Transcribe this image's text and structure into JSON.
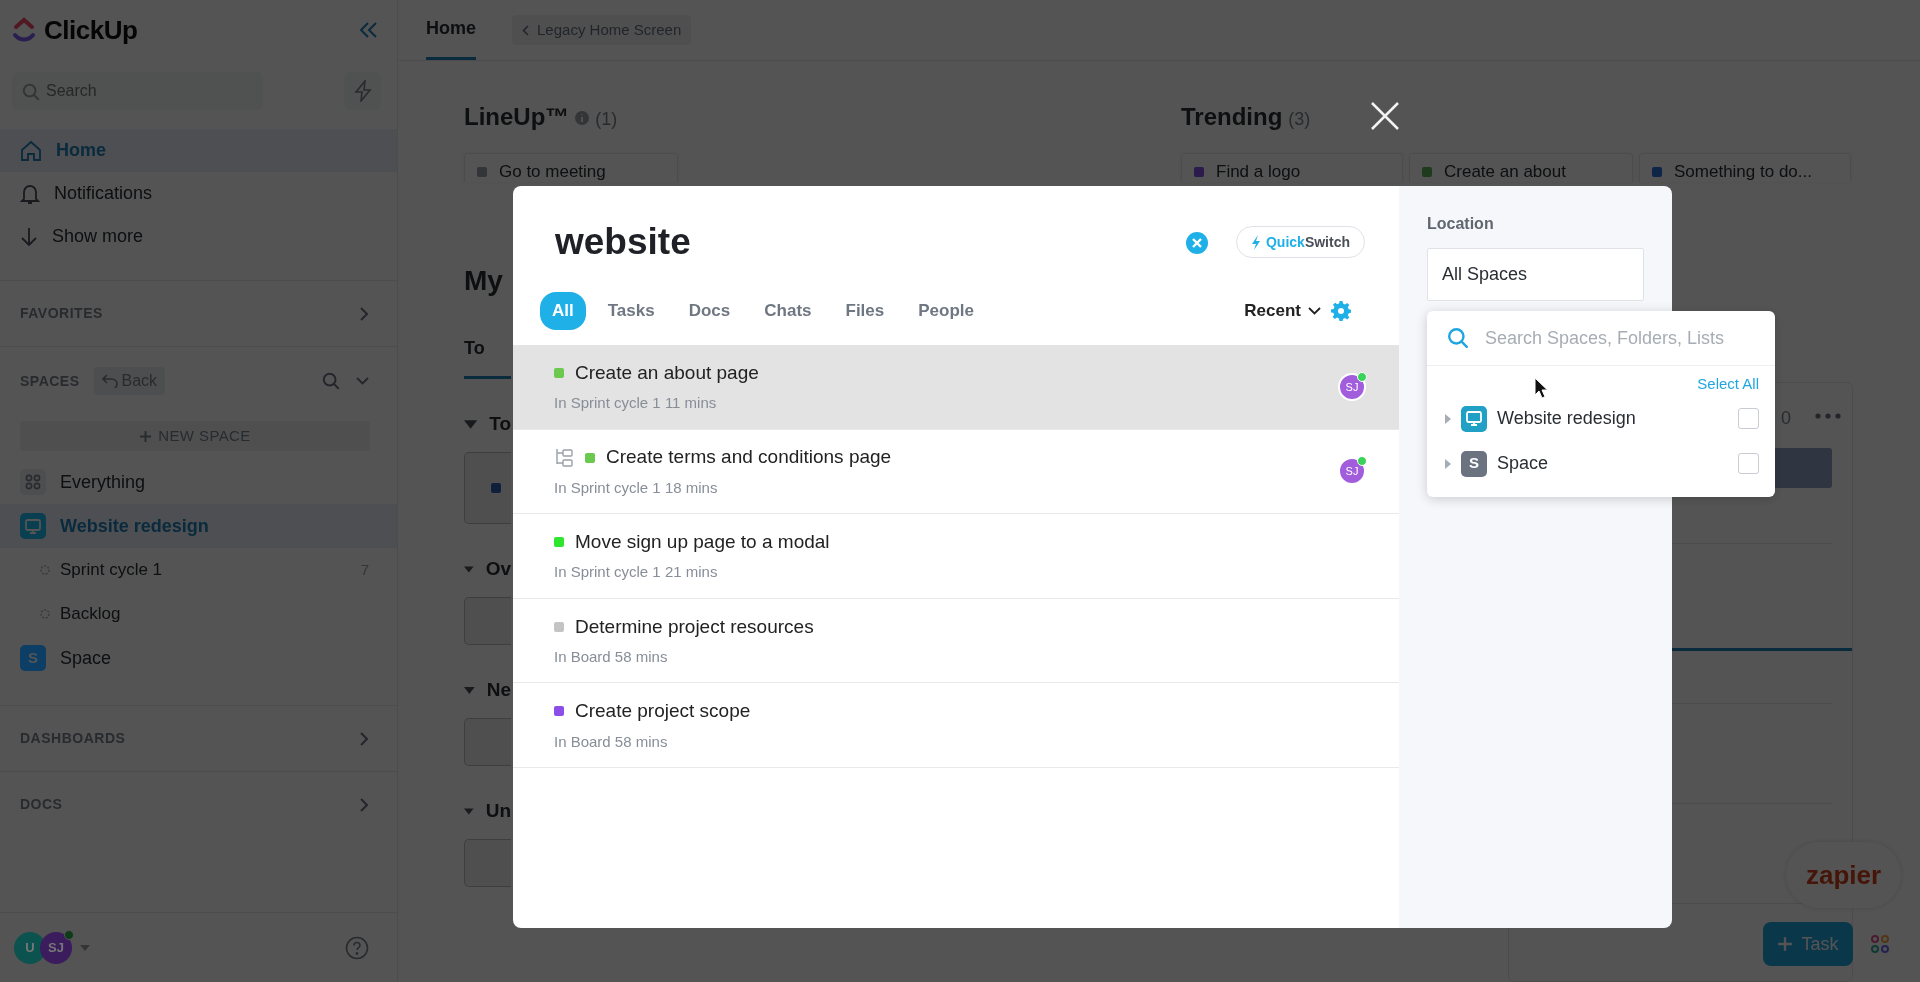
{
  "sidebar": {
    "logo": "ClickUp",
    "search": {
      "placeholder": "Search"
    },
    "nav": [
      {
        "kind": "home",
        "label": "Home",
        "selected": true
      },
      {
        "kind": "bell",
        "label": "Notifications",
        "selected": false
      },
      {
        "kind": "arrow",
        "label": "Show more",
        "selected": false
      }
    ],
    "favorites": {
      "title": "FAVORITES"
    },
    "spaces": {
      "title": "SPACES",
      "back": "Back",
      "new_space": "NEW SPACE",
      "items": [
        {
          "kind": "all",
          "label": "Everything",
          "selected": false
        },
        {
          "kind": "space",
          "label": "Website redesign",
          "color": "#0a3f52",
          "selected": true,
          "children": [
            {
              "kind": "list",
              "label": "Sprint cycle 1",
              "count": "7",
              "selected": false
            },
            {
              "kind": "list",
              "label": "Backlog",
              "selected": false
            }
          ]
        },
        {
          "kind": "space",
          "label": "Space",
          "letter": "S",
          "color": "#0d3f66",
          "selected": false
        }
      ]
    },
    "sections": [
      {
        "title": "DASHBOARDS"
      },
      {
        "title": "DOCS"
      }
    ],
    "avatars": [
      {
        "initials": "U",
        "color": "#0c5350",
        "online": false
      },
      {
        "initials": "SJ",
        "color": "#3b1c5c",
        "online": true
      }
    ]
  },
  "main": {
    "tabs": [
      {
        "label": "Home",
        "selected": true
      }
    ],
    "legacy": "Legacy Home Screen",
    "lineup": {
      "title": "LineUp™",
      "count": "(1)",
      "cards": [
        {
          "label": "Go to meeting",
          "color": "#333538"
        }
      ]
    },
    "trending": {
      "title": "Trending",
      "count": "(3)",
      "cards": [
        {
          "label": "Find a logo",
          "color": "#2b1a4c"
        },
        {
          "label": "Create an about",
          "color": "#1e3b1e"
        },
        {
          "label": "Something to do...",
          "color": "#0f2548"
        }
      ]
    },
    "my_work": {
      "title": "My",
      "tab": "To",
      "sections": [
        {
          "label": "To",
          "color": "#0e1f3a"
        },
        {
          "label": "Ov"
        },
        {
          "label": "Ne"
        },
        {
          "label": "Un"
        }
      ]
    },
    "side_card": {
      "count": "0"
    },
    "zapier": "zapier",
    "task_button": "Task"
  },
  "search": {
    "query": "website",
    "quickswitch": {
      "prefix": "Quick",
      "rest": "Switch"
    },
    "tabs": [
      {
        "label": "All",
        "selected": true
      },
      {
        "label": "Tasks",
        "selected": false
      },
      {
        "label": "Docs",
        "selected": false
      },
      {
        "label": "Chats",
        "selected": false
      },
      {
        "label": "Files",
        "selected": false
      },
      {
        "label": "People",
        "selected": false
      }
    ],
    "sort": "Recent",
    "results": [
      {
        "title": "Create an about page",
        "subtitle": "In Sprint cycle 1 11 mins",
        "color": "#6bc950",
        "selected": true,
        "subtask": false,
        "assignee": {
          "initials": "SJ",
          "online": true
        }
      },
      {
        "title": "Create terms and conditions page",
        "subtitle": "In Sprint cycle 1 18 mins",
        "color": "#6bc950",
        "selected": false,
        "subtask": true,
        "assignee": {
          "initials": "SJ",
          "online": true
        }
      },
      {
        "title": "Move sign up page to a modal",
        "subtitle": "In Sprint cycle 1 21 mins",
        "color": "#2ee62e",
        "selected": false,
        "subtask": false
      },
      {
        "title": "Determine project resources",
        "subtitle": "In Board 58 mins",
        "color": "#c4c4c4",
        "selected": false,
        "subtask": false
      },
      {
        "title": "Create project scope",
        "subtitle": "In Board 58 mins",
        "color": "#8d4de8",
        "selected": false,
        "subtask": false
      }
    ],
    "location": {
      "label": "Location",
      "value": "All Spaces",
      "dropdown": {
        "placeholder": "Search Spaces, Folders, Lists",
        "select_all": "Select All",
        "items": [
          {
            "label": "Website redesign",
            "color": "#1fa0c4",
            "checked": false
          },
          {
            "label": "Space",
            "letter": "S",
            "color": "#6b7280",
            "checked": false
          }
        ]
      }
    }
  }
}
